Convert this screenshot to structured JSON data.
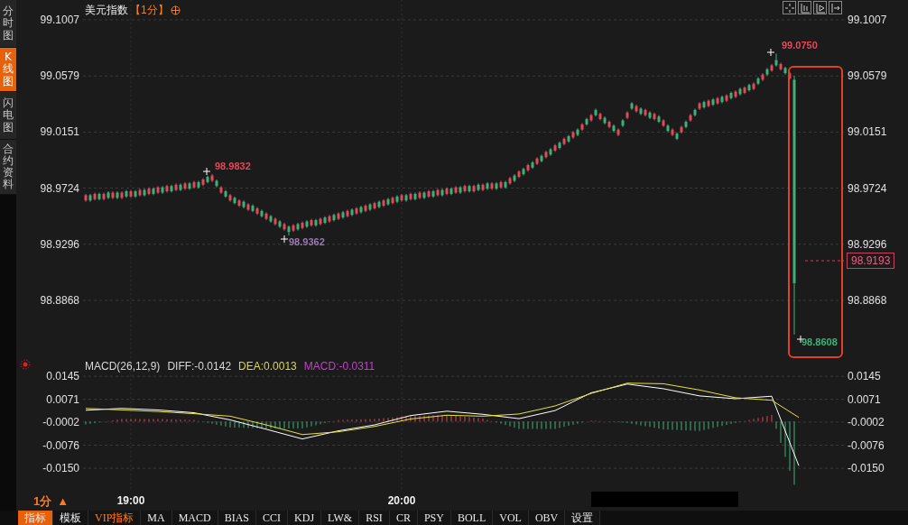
{
  "sidebar": {
    "tabs": [
      {
        "label": "分时图",
        "selected": false
      },
      {
        "label": "K线图",
        "selected": true
      },
      {
        "label": "闪电图",
        "selected": false
      },
      {
        "label": "合约资料",
        "selected": false
      }
    ]
  },
  "header": {
    "symbol": "美元指数",
    "period": "【1分】"
  },
  "price_chart": {
    "chart_data": {
      "type": "candlestick",
      "grid": true,
      "x": [
        18.8333,
        18.85,
        18.8667,
        18.8833,
        18.9,
        18.9167,
        18.9333,
        18.95,
        18.9667,
        18.9833,
        19,
        19.0167,
        19.0333,
        19.05,
        19.0667,
        19.0833,
        19.1,
        19.1167,
        19.1333,
        19.15,
        19.1667,
        19.1833,
        19.2,
        19.2167,
        19.2333,
        19.25,
        19.2667,
        19.2833,
        19.3,
        19.3167,
        19.3333,
        19.35,
        19.3667,
        19.3833,
        19.4,
        19.4167,
        19.4333,
        19.45,
        19.4667,
        19.4833,
        19.5,
        19.5167,
        19.5333,
        19.55,
        19.5667,
        19.5833,
        19.6,
        19.6167,
        19.6333,
        19.65,
        19.6667,
        19.6833,
        19.7,
        19.7167,
        19.7333,
        19.75,
        19.7667,
        19.7833,
        19.8,
        19.8167,
        19.8333,
        19.85,
        19.8667,
        19.8833,
        19.9,
        19.9167,
        19.9333,
        19.95,
        19.9667,
        19.9833,
        20,
        20.0167,
        20.0333,
        20.05,
        20.0667,
        20.0833,
        20.1,
        20.1167,
        20.1333,
        20.15,
        20.1667,
        20.1833,
        20.2,
        20.2167,
        20.2333,
        20.25,
        20.2667,
        20.2833,
        20.3,
        20.3167,
        20.3333,
        20.35,
        20.3667,
        20.3833,
        20.4,
        20.4167,
        20.4333,
        20.45,
        20.4667,
        20.4833,
        20.5,
        20.5167,
        20.5333,
        20.55,
        20.5667,
        20.5833,
        20.6,
        20.6167,
        20.6333,
        20.65,
        20.6667,
        20.6833,
        20.7,
        20.7167,
        20.7333,
        20.75,
        20.7667,
        20.7833,
        20.8,
        20.8167,
        20.8333,
        20.85,
        20.8667,
        20.8833,
        20.9,
        20.9167,
        20.9333,
        20.95,
        20.9667,
        20.9833,
        21,
        21.0167,
        21.0333,
        21.05,
        21.0667,
        21.0833,
        21.1,
        21.1167,
        21.1333,
        21.15,
        21.1667,
        21.1833,
        21.2,
        21.2167,
        21.2333,
        21.25,
        21.2667,
        21.2833,
        21.3,
        21.3167,
        21.3333,
        21.35,
        21.3667,
        21.3833,
        21.4,
        21.4167,
        21.4333,
        21.45
      ],
      "xlim": [
        18.8233,
        21.6333
      ],
      "ylim": [
        98.8442,
        99.1158
      ],
      "yticks": [
        {
          "value": 99.1007,
          "label": "99.1007"
        },
        {
          "value": 99.0579,
          "label": "99.0579"
        },
        {
          "value": 99.0151,
          "label": "99.0151"
        },
        {
          "value": 98.9724,
          "label": "98.9724"
        },
        {
          "value": 98.9296,
          "label": "98.9296"
        },
        {
          "value": 98.8868,
          "label": "98.8868"
        }
      ],
      "ohlc": [
        [
          98.963,
          98.968,
          98.962,
          98.967
        ],
        [
          98.967,
          98.968,
          98.962,
          98.963
        ],
        [
          98.964,
          98.969,
          98.963,
          98.968
        ],
        [
          98.968,
          98.969,
          98.963,
          98.964
        ],
        [
          98.964,
          98.969,
          98.963,
          98.968
        ],
        [
          98.969,
          98.97,
          98.964,
          98.965
        ],
        [
          98.965,
          98.97,
          98.964,
          98.969
        ],
        [
          98.969,
          98.97,
          98.964,
          98.965
        ],
        [
          98.965,
          98.97,
          98.964,
          98.969
        ],
        [
          98.97,
          98.971,
          98.965,
          98.966
        ],
        [
          98.966,
          98.971,
          98.965,
          98.97
        ],
        [
          98.97,
          98.971,
          98.965,
          98.966
        ],
        [
          98.967,
          98.972,
          98.966,
          98.971
        ],
        [
          98.971,
          98.972,
          98.966,
          98.967
        ],
        [
          98.968,
          98.973,
          98.967,
          98.972
        ],
        [
          98.972,
          98.973,
          98.967,
          98.968
        ],
        [
          98.969,
          98.974,
          98.968,
          98.973
        ],
        [
          98.973,
          98.974,
          98.968,
          98.969
        ],
        [
          98.97,
          98.975,
          98.969,
          98.974
        ],
        [
          98.974,
          98.975,
          98.969,
          98.97
        ],
        [
          98.971,
          98.976,
          98.97,
          98.975
        ],
        [
          98.975,
          98.976,
          98.97,
          98.971
        ],
        [
          98.972,
          98.977,
          98.971,
          98.976
        ],
        [
          98.976,
          98.977,
          98.971,
          98.972
        ],
        [
          98.973,
          98.978,
          98.972,
          98.977
        ],
        [
          98.977,
          98.978,
          98.972,
          98.973
        ],
        [
          98.975,
          98.98,
          98.974,
          98.979
        ],
        [
          98.981,
          98.982,
          98.976,
          98.977
        ],
        [
          98.978,
          98.9832,
          98.977,
          98.982
        ],
        [
          98.978,
          98.979,
          98.973,
          98.974
        ],
        [
          98.969,
          98.974,
          98.968,
          98.973
        ],
        [
          98.97,
          98.971,
          98.965,
          98.966
        ],
        [
          98.963,
          98.968,
          98.962,
          98.967
        ],
        [
          98.965,
          98.966,
          98.96,
          98.961
        ],
        [
          98.959,
          98.964,
          98.958,
          98.963
        ],
        [
          98.962,
          98.963,
          98.957,
          98.958
        ],
        [
          98.956,
          98.961,
          98.955,
          98.96
        ],
        [
          98.959,
          98.96,
          98.954,
          98.955
        ],
        [
          98.953,
          98.958,
          98.952,
          98.957
        ],
        [
          98.955,
          98.956,
          98.95,
          98.951
        ],
        [
          98.949,
          98.954,
          98.948,
          98.953
        ],
        [
          98.951,
          98.952,
          98.946,
          98.947
        ],
        [
          98.945,
          98.95,
          98.944,
          98.949
        ],
        [
          98.947,
          98.948,
          98.942,
          98.943
        ],
        [
          98.941,
          98.946,
          98.94,
          98.945
        ],
        [
          98.943,
          98.944,
          98.9362,
          98.939
        ],
        [
          98.94,
          98.945,
          98.939,
          98.944
        ],
        [
          98.945,
          98.946,
          98.94,
          98.941
        ],
        [
          98.942,
          98.947,
          98.941,
          98.946
        ],
        [
          98.947,
          98.948,
          98.942,
          98.943
        ],
        [
          98.944,
          98.949,
          98.943,
          98.948
        ],
        [
          98.948,
          98.949,
          98.943,
          98.944
        ],
        [
          98.945,
          98.95,
          98.944,
          98.949
        ],
        [
          98.95,
          98.951,
          98.945,
          98.946
        ],
        [
          98.947,
          98.952,
          98.946,
          98.951
        ],
        [
          98.952,
          98.953,
          98.947,
          98.948
        ],
        [
          98.949,
          98.954,
          98.948,
          98.953
        ],
        [
          98.954,
          98.955,
          98.949,
          98.95
        ],
        [
          98.951,
          98.956,
          98.95,
          98.955
        ],
        [
          98.956,
          98.957,
          98.951,
          98.952
        ],
        [
          98.953,
          98.958,
          98.952,
          98.957
        ],
        [
          98.958,
          98.959,
          98.953,
          98.954
        ],
        [
          98.955,
          98.96,
          98.954,
          98.959
        ],
        [
          98.96,
          98.961,
          98.955,
          98.956
        ],
        [
          98.957,
          98.962,
          98.956,
          98.961
        ],
        [
          98.962,
          98.963,
          98.957,
          98.958
        ],
        [
          98.959,
          98.964,
          98.958,
          98.963
        ],
        [
          98.964,
          98.965,
          98.959,
          98.96
        ],
        [
          98.961,
          98.966,
          98.96,
          98.965
        ],
        [
          98.966,
          98.967,
          98.961,
          98.962
        ],
        [
          98.963,
          98.968,
          98.962,
          98.967
        ],
        [
          98.967,
          98.968,
          98.962,
          98.963
        ],
        [
          98.964,
          98.969,
          98.963,
          98.968
        ],
        [
          98.968,
          98.969,
          98.963,
          98.964
        ],
        [
          98.965,
          98.97,
          98.964,
          98.969
        ],
        [
          98.969,
          98.97,
          98.964,
          98.965
        ],
        [
          98.966,
          98.971,
          98.965,
          98.97
        ],
        [
          98.97,
          98.971,
          98.965,
          98.966
        ],
        [
          98.967,
          98.972,
          98.966,
          98.971
        ],
        [
          98.971,
          98.972,
          98.966,
          98.967
        ],
        [
          98.968,
          98.973,
          98.967,
          98.972
        ],
        [
          98.972,
          98.973,
          98.967,
          98.968
        ],
        [
          98.969,
          98.974,
          98.968,
          98.973
        ],
        [
          98.973,
          98.974,
          98.968,
          98.969
        ],
        [
          98.97,
          98.975,
          98.969,
          98.974
        ],
        [
          98.974,
          98.975,
          98.969,
          98.97
        ],
        [
          98.97,
          98.975,
          98.969,
          98.974
        ],
        [
          98.975,
          98.976,
          98.97,
          98.971
        ],
        [
          98.971,
          98.976,
          98.97,
          98.975
        ],
        [
          98.976,
          98.977,
          98.971,
          98.972
        ],
        [
          98.972,
          98.977,
          98.971,
          98.976
        ],
        [
          98.976,
          98.977,
          98.971,
          98.972
        ],
        [
          98.973,
          98.978,
          98.972,
          98.977
        ],
        [
          98.977,
          98.978,
          98.972,
          98.973
        ],
        [
          98.976,
          98.981,
          98.975,
          98.98
        ],
        [
          98.982,
          98.983,
          98.977,
          98.978
        ],
        [
          98.981,
          98.986,
          98.98,
          98.985
        ],
        [
          98.987,
          98.988,
          98.982,
          98.983
        ],
        [
          98.986,
          98.991,
          98.985,
          98.99
        ],
        [
          98.992,
          98.993,
          98.987,
          98.988
        ],
        [
          98.991,
          98.996,
          98.99,
          98.995
        ],
        [
          98.997,
          98.998,
          98.992,
          98.993
        ],
        [
          98.996,
          99.001,
          98.995,
          99.0
        ],
        [
          99.002,
          99.003,
          98.997,
          98.998
        ],
        [
          99.001,
          99.006,
          99.0,
          99.005
        ],
        [
          99.007,
          99.008,
          99.002,
          99.003
        ],
        [
          99.006,
          99.011,
          99.005,
          99.01
        ],
        [
          99.012,
          99.013,
          99.007,
          99.008
        ],
        [
          99.011,
          99.016,
          99.01,
          99.015
        ],
        [
          99.017,
          99.018,
          99.012,
          99.013
        ],
        [
          99.017,
          99.022,
          99.016,
          99.021
        ],
        [
          99.025,
          99.026,
          99.02,
          99.021
        ],
        [
          99.024,
          99.029,
          99.023,
          99.028
        ],
        [
          99.032,
          99.033,
          99.027,
          99.028
        ],
        [
          99.025,
          99.03,
          99.024,
          99.029
        ],
        [
          99.026,
          99.027,
          99.021,
          99.022
        ],
        [
          99.019,
          99.024,
          99.018,
          99.023
        ],
        [
          99.02,
          99.021,
          99.015,
          99.016
        ],
        [
          99.013,
          99.018,
          99.012,
          99.017
        ],
        [
          99.024,
          99.025,
          99.019,
          99.02
        ],
        [
          99.026,
          99.031,
          99.025,
          99.03
        ],
        [
          99.037,
          99.038,
          99.032,
          99.033
        ],
        [
          99.031,
          99.036,
          99.03,
          99.035
        ],
        [
          99.033,
          99.034,
          99.028,
          99.029
        ],
        [
          99.028,
          99.033,
          99.027,
          99.032
        ],
        [
          99.03,
          99.031,
          99.025,
          99.026
        ],
        [
          99.025,
          99.03,
          99.024,
          99.029
        ],
        [
          99.027,
          99.028,
          99.022,
          99.023
        ],
        [
          99.02,
          99.025,
          99.019,
          99.024
        ],
        [
          99.02,
          99.021,
          99.015,
          99.016
        ],
        [
          99.013,
          99.018,
          99.012,
          99.017
        ],
        [
          99.014,
          99.015,
          99.009,
          99.01
        ],
        [
          99.015,
          99.02,
          99.014,
          99.019
        ],
        [
          99.023,
          99.024,
          99.018,
          99.019
        ],
        [
          99.024,
          99.029,
          99.023,
          99.028
        ],
        [
          99.032,
          99.033,
          99.027,
          99.028
        ],
        [
          99.033,
          99.038,
          99.032,
          99.037
        ],
        [
          99.038,
          99.039,
          99.033,
          99.034
        ],
        [
          99.035,
          99.04,
          99.034,
          99.039
        ],
        [
          99.04,
          99.041,
          99.035,
          99.036
        ],
        [
          99.037,
          99.042,
          99.036,
          99.041
        ],
        [
          99.042,
          99.043,
          99.037,
          99.038
        ],
        [
          99.039,
          99.044,
          99.038,
          99.043
        ],
        [
          99.045,
          99.046,
          99.04,
          99.041
        ],
        [
          99.042,
          99.047,
          99.041,
          99.046
        ],
        [
          99.048,
          99.049,
          99.043,
          99.044
        ],
        [
          99.045,
          99.05,
          99.044,
          99.049
        ],
        [
          99.051,
          99.052,
          99.046,
          99.047
        ],
        [
          99.048,
          99.053,
          99.047,
          99.052
        ],
        [
          99.056,
          99.057,
          99.051,
          99.052
        ],
        [
          99.055,
          99.06,
          99.054,
          99.059
        ],
        [
          99.063,
          99.064,
          99.058,
          99.059
        ],
        [
          99.062,
          99.067,
          99.061,
          99.066
        ],
        [
          99.07,
          99.075,
          99.065,
          99.066
        ],
        [
          99.063,
          99.068,
          99.062,
          99.067
        ],
        [
          99.064,
          99.065,
          99.059,
          99.06
        ],
        [
          99.056,
          99.061,
          99.055,
          99.06
        ],
        [
          99.055,
          99.058,
          98.8608,
          98.9
        ]
      ]
    }
  },
  "price_marks": [
    {
      "text": "98.9832",
      "kind": "high"
    },
    {
      "text": "98.9362",
      "kind": "low"
    },
    {
      "text": "99.0750",
      "kind": "high"
    },
    {
      "text": "98.8608",
      "kind": "low"
    }
  ],
  "current_price": "98.9193",
  "macd": {
    "chart_data": {
      "type": "line",
      "grid": true,
      "x": [
        18.8333,
        18.9667,
        19.1,
        19.2333,
        19.3667,
        19.5,
        19.6333,
        19.7667,
        19.9,
        20.0333,
        20.1667,
        20.3,
        20.4333,
        20.5667,
        20.7,
        20.8333,
        20.9667,
        21.1,
        21.2333,
        21.3667,
        21.4667
      ],
      "xticks": [
        {
          "value": 19,
          "label": "19:00"
        },
        {
          "value": 20,
          "label": "20:00"
        }
      ],
      "xlim": [
        18.8233,
        21.6333
      ],
      "ylim": [
        -0.0225,
        0.0209
      ],
      "yticks": [
        {
          "value": 0.0145,
          "label": "0.0145"
        },
        {
          "value": 0.0071,
          "label": "0.0071"
        },
        {
          "value": -0.0002,
          "label": "-0.0002"
        },
        {
          "value": -0.0076,
          "label": "-0.0076"
        },
        {
          "value": -0.015,
          "label": "-0.0150"
        }
      ],
      "series": [
        {
          "color": "#ffffff",
          "values": [
            0.0036,
            0.0042,
            0.0037,
            0.0028,
            0.0005,
            -0.0025,
            -0.0056,
            -0.003,
            -0.0011,
            0.0019,
            0.0033,
            0.0023,
            0.0009,
            0.0035,
            0.0092,
            0.012,
            0.0105,
            0.0082,
            0.0073,
            0.0081,
            -0.0142
          ]
        },
        {
          "color": "#e8e040",
          "values": [
            0.0042,
            0.0037,
            0.0032,
            0.0025,
            0.0017,
            -0.0011,
            -0.0042,
            -0.0033,
            -0.0016,
            0.0008,
            0.002,
            0.0017,
            0.0024,
            0.005,
            0.009,
            0.0123,
            0.0121,
            0.0101,
            0.0076,
            0.0068,
            0.0013
          ]
        }
      ]
    },
    "title": "MACD(26,12,9)",
    "diff": "DIFF:-0.0142",
    "dea": "DEA:0.0013",
    "macd": "MACD:-0.0311"
  },
  "time_axis": {
    "period": "1分",
    "period_arrow": "▲"
  },
  "toolbar": [
    {
      "label": "指标",
      "kind": "tab",
      "selected": true
    },
    {
      "label": "模板",
      "kind": "tab",
      "selected": false
    },
    {
      "label": "VIP指标",
      "kind": "vip",
      "selected": false
    },
    {
      "label": "MA",
      "kind": "tab",
      "selected": false
    },
    {
      "label": "MACD",
      "kind": "tab",
      "selected": false
    },
    {
      "label": "BIAS",
      "kind": "tab",
      "selected": false
    },
    {
      "label": "CCI",
      "kind": "tab",
      "selected": false
    },
    {
      "label": "KDJ",
      "kind": "tab",
      "selected": false
    },
    {
      "label": "LW&",
      "kind": "tab",
      "selected": false
    },
    {
      "label": "RSI",
      "kind": "tab",
      "selected": false
    },
    {
      "label": "CR",
      "kind": "tab",
      "selected": false
    },
    {
      "label": "PSY",
      "kind": "tab",
      "selected": false
    },
    {
      "label": "BOLL",
      "kind": "tab",
      "selected": false
    },
    {
      "label": "VOL",
      "kind": "tab",
      "selected": false
    },
    {
      "label": "OBV",
      "kind": "tab",
      "selected": false
    },
    {
      "label": "设置",
      "kind": "tab",
      "selected": false
    }
  ]
}
